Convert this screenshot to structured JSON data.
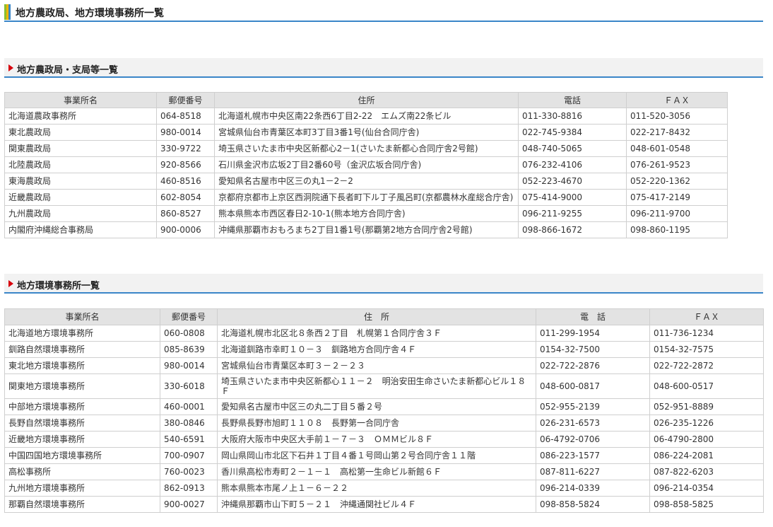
{
  "page_title": "地方農政局、地方環境事務所一覧",
  "section1": {
    "title": "地方農政局・支局等一覧",
    "headers": [
      "事業所名",
      "郵便番号",
      "住所",
      "電話",
      "ＦＡＸ"
    ],
    "rows": [
      [
        "北海道農政事務所",
        "064-8518",
        "北海道札幌市中央区南22条西6丁目2-22　エムズ南22条ビル",
        "011-330-8816",
        "011-520-3056"
      ],
      [
        "東北農政局",
        "980-0014",
        "宮城県仙台市青葉区本町3丁目3番1号(仙台合同庁舎)",
        "022-745-9384",
        "022-217-8432"
      ],
      [
        "関東農政局",
        "330-9722",
        "埼玉県さいたま市中央区新都心2－1(さいたま新都心合同庁舎2号館)",
        "048-740-5065",
        "048-601-0548"
      ],
      [
        "北陸農政局",
        "920-8566",
        "石川県金沢市広坂2丁目2番60号（金沢広坂合同庁舎)",
        "076-232-4106",
        "076-261-9523"
      ],
      [
        "東海農政局",
        "460-8516",
        "愛知県名古屋市中区三の丸1－2－2",
        "052-223-4670",
        "052-220-1362"
      ],
      [
        "近畿農政局",
        "602-8054",
        "京都府京都市上京区西洞院通下長者町下ル丁子風呂町(京都農林水産総合庁舎)",
        "075-414-9000",
        "075-417-2149"
      ],
      [
        "九州農政局",
        "860-8527",
        "熊本県熊本市西区春日2-10-1(熊本地方合同庁舎)",
        "096-211-9255",
        "096-211-9700"
      ],
      [
        "内閣府沖縄総合事務局",
        "900-0006",
        "沖縄県那覇市おもろまち2丁目1番1号(那覇第2地方合同庁舎2号館)",
        "098-866-1672",
        "098-860-1195"
      ]
    ]
  },
  "section2": {
    "title": "地方環境事務所一覧",
    "headers": [
      "事業所名",
      "郵便番号",
      "住　所",
      "電　話",
      "ＦＡＸ"
    ],
    "rows": [
      [
        "北海道地方環境事務所",
        "060-0808",
        "北海道札幌市北区北８条西２丁目　札幌第１合同庁舎３Ｆ",
        "011-299-1954",
        "011-736-1234"
      ],
      [
        "釧路自然環境事務所",
        "085-8639",
        "北海道釧路市幸町１０－３　釧路地方合同庁舎４Ｆ",
        "0154-32-7500",
        "0154-32-7575"
      ],
      [
        "東北地方環境事務所",
        "980-0014",
        "宮城県仙台市青葉区本町３－２－２３",
        "022-722-2876",
        "022-722-2872"
      ],
      [
        "関東地方環境事務所",
        "330-6018",
        "埼玉県さいたま市中央区新都心１１－２　明治安田生命さいたま新都心ビル１８Ｆ",
        "048-600-0817",
        "048-600-0517"
      ],
      [
        "中部地方環境事務所",
        "460-0001",
        "愛知県名古屋市中区三の丸二丁目５番２号",
        "052-955-2139",
        "052-951-8889"
      ],
      [
        "長野自然環境事務所",
        "380-0846",
        "長野県長野市旭町１１０８　長野第一合同庁舎",
        "026-231-6573",
        "026-235-1226"
      ],
      [
        "近畿地方環境事務所",
        "540-6591",
        "大阪府大阪市中央区大手前１－７－３　ＯＭＭビル８Ｆ",
        "06-4792-0706",
        "06-4790-2800"
      ],
      [
        "中国四国地方環境事務所",
        "700-0907",
        "岡山県岡山市北区下石井１丁目４番１号岡山第２号合同庁舎１１階",
        "086-223-1577",
        "086-224-2081"
      ],
      [
        "高松事務所",
        "760-0023",
        "香川県高松市寿町２－１－１　高松第一生命ビル新館６Ｆ",
        "087-811-6227",
        "087-822-6203"
      ],
      [
        "九州地方環境事務所",
        "862-0913",
        "熊本県熊本市尾ノ上１－６－２２",
        "096-214-0339",
        "096-214-0354"
      ],
      [
        "那覇自然環境事務所",
        "900-0027",
        "沖縄県那覇市山下町５－２１　沖縄通関社ビル４Ｆ",
        "098-858-5824",
        "098-858-5825"
      ]
    ]
  }
}
